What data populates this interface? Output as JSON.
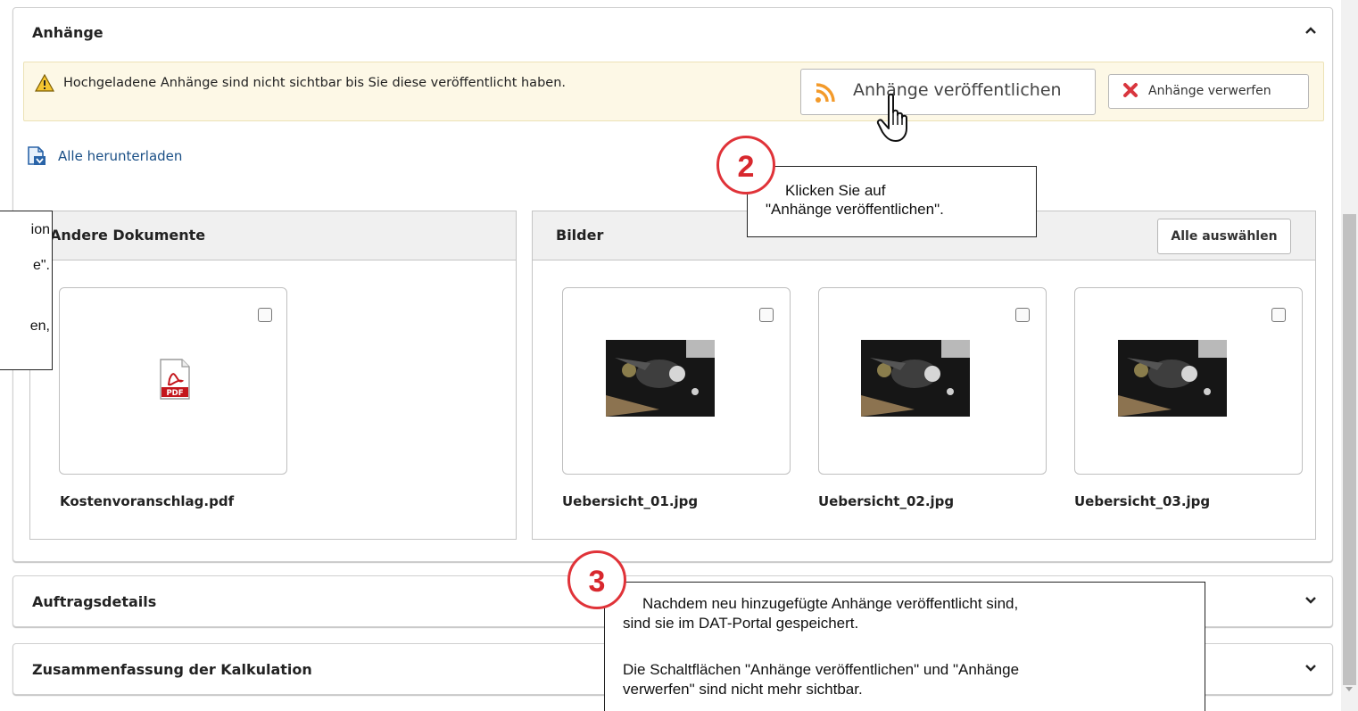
{
  "attachments_panel": {
    "title": "Anhänge",
    "warning_text": "Hochgeladene Anhänge sind nicht sichtbar bis Sie diese veröffentlicht haben.",
    "publish_button": "Anhänge veröffentlichen",
    "discard_button": "Anhänge verwerfen",
    "download_all": "Alle herunterladen",
    "documents_section": {
      "title": "Andere Dokumente",
      "files": [
        {
          "name": "Kostenvoranschlag.pdf",
          "icon": "pdf-icon",
          "checked": false
        }
      ]
    },
    "images_section": {
      "title": "Bilder",
      "select_all_button": "Alle auswählen",
      "files": [
        {
          "name": "Uebersicht_01.jpg",
          "checked": false
        },
        {
          "name": "Uebersicht_02.jpg",
          "checked": false
        },
        {
          "name": "Uebersicht_03.jpg",
          "checked": false
        }
      ]
    }
  },
  "order_details_panel": {
    "title": "Auftragsdetails"
  },
  "calculation_panel": {
    "title": "Zusammenfassung der Kalkulation"
  },
  "callouts": {
    "step2": {
      "number": "2",
      "line1": "Klicken Sie auf",
      "line2": "\"Anhänge veröffentlichen\"."
    },
    "step3": {
      "number": "3",
      "line1": "Nachdem neu hinzugefügte Anhänge veröffentlicht sind,",
      "line2": "sind sie im DAT-Portal gespeichert.",
      "line3": "Die Schaltflächen \"Anhänge veröffentlichen\" und \"Anhänge",
      "line4": "verwerfen\" sind nicht mehr sichtbar."
    },
    "left_fragment": {
      "line1": "ion",
      "line2": "e\".",
      "line3": "en,"
    }
  },
  "colors": {
    "accent_red": "#d8282e",
    "link_blue": "#1a4f86",
    "warning_bg": "#fdf8e6",
    "rss_orange": "#f39a2a"
  }
}
